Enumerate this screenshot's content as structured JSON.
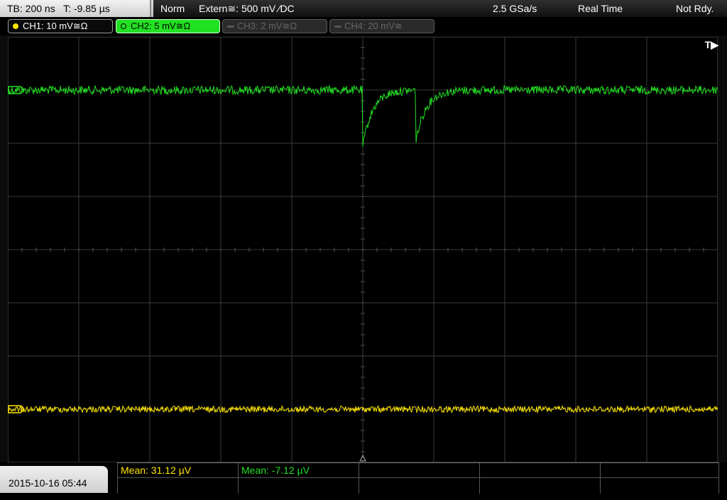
{
  "top_bar": {
    "timebase": "TB: 200 ns   T: -9.85 µs",
    "trigger_mode": "Norm",
    "trigger_source": "Extern≅: 500 mV ⁄DC",
    "sample_rate": "2.5 GSa/s",
    "acq_mode": "Real Time",
    "status": "Not Rdy."
  },
  "channels": [
    {
      "label": "CH1: 10 mV≅Ω",
      "color": "#ffe600",
      "state": "on"
    },
    {
      "label": "CH2: 5 mV≅Ω",
      "color": "#22e022",
      "state": "selected"
    },
    {
      "label": "CH3: 2 mV≅Ω",
      "color": "#555555",
      "state": "off"
    },
    {
      "label": "CH4: 20 mV≅",
      "color": "#555555",
      "state": "off"
    }
  ],
  "display": {
    "trigger_marker": "T▶",
    "h_divisions": 10,
    "v_divisions": 8
  },
  "traces": {
    "ch2": {
      "color": "#22e022",
      "level_div": -3.0,
      "noise_div": 0.08,
      "dips": [
        {
          "t_div": 0.0,
          "depth_div": 1.05
        },
        {
          "t_div": 0.75,
          "depth_div": 0.95
        }
      ]
    },
    "ch1": {
      "color": "#ffe600",
      "level_div": 3.0,
      "noise_div": 0.06
    }
  },
  "footer": {
    "datetime": "2015-10-16 05:44",
    "measurements": [
      {
        "text": "Mean: 31.12 µV",
        "color": "#ffe600"
      },
      {
        "text": "Mean: -7.12 µV",
        "color": "#22e022"
      },
      {
        "text": "",
        "color": "#ffffff"
      },
      {
        "text": "",
        "color": "#ffffff"
      },
      {
        "text": "",
        "color": "#ffffff"
      }
    ]
  }
}
